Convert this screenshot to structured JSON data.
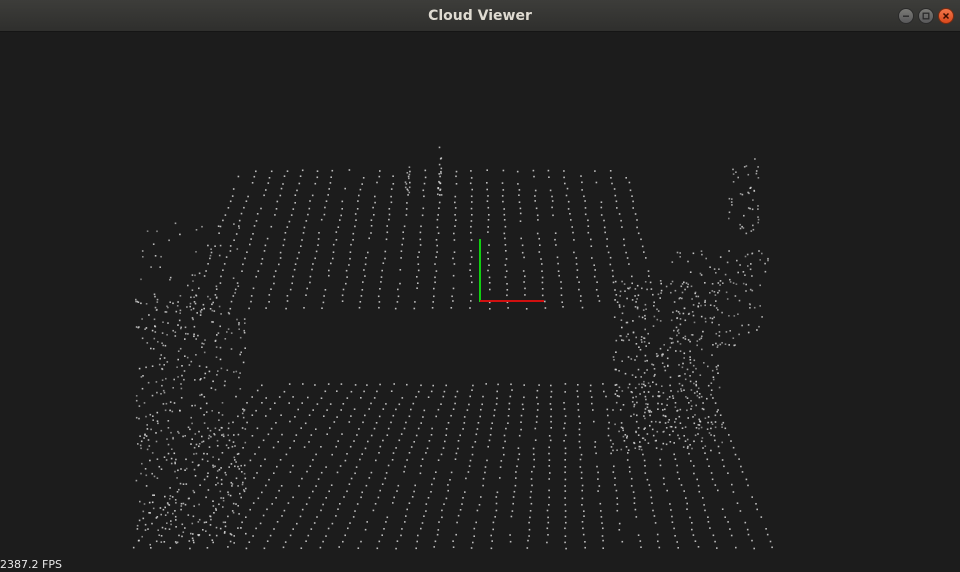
{
  "window": {
    "title": "Cloud Viewer",
    "controls": [
      "minimize",
      "maximize",
      "close"
    ]
  },
  "viewport": {
    "background": "#1c1c1c",
    "point_color": "#d8d8d8",
    "axes": {
      "x_color": "#d01010",
      "y_color": "#10d010"
    },
    "fps_label": "2387.2 FPS"
  }
}
